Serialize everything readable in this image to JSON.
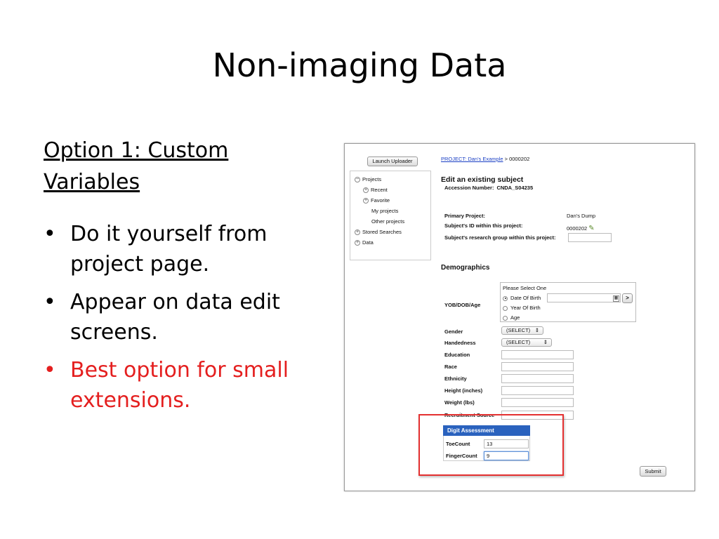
{
  "slide": {
    "title": "Non-imaging Data",
    "heading": "Option 1: Custom Variables",
    "bullets": [
      {
        "text": "Do it yourself from project page."
      },
      {
        "text": "Appear on data edit screens."
      },
      {
        "text": "Best option for small extensions.",
        "color": "#e41f1f"
      }
    ]
  },
  "screenshot": {
    "launch_uploader": "Launch Uploader",
    "tree": {
      "projects": "Projects",
      "recent": "Recent",
      "favorite": "Favorite",
      "my_projects": "My projects",
      "other_projects": "Other projects",
      "stored_searches": "Stored Searches",
      "data": "Data"
    },
    "breadcrumb": {
      "link": "PROJECT: Dan's Example",
      "rest": " > 0000202"
    },
    "heading": "Edit an existing subject",
    "accession_label": "Accession Number:",
    "accession_value": "CNDA_S04235",
    "primary_project_label": "Primary Project:",
    "primary_project_value": "Dan's Dump",
    "subject_id_label": "Subject's ID within this project:",
    "subject_id_value": "0000202",
    "research_group_label": "Subject's research group within this project:",
    "demographics_heading": "Demographics",
    "yob_label": "YOB/DOB/Age",
    "yob_prompt": "Please Select One",
    "yob_options": [
      "Date Of Birth",
      "Year Of Birth",
      "Age"
    ],
    "go_glyph": ">",
    "gender_label": "Gender",
    "gender_value": "(SELECT)",
    "handedness_label": "Handedness",
    "handedness_value": "(SELECT)",
    "education_label": "Education",
    "race_label": "Race",
    "ethnicity_label": "Ethnicity",
    "height_label": "Height (inches)",
    "weight_label": "Weight (lbs)",
    "recruitment_label": "Recruitment Source",
    "digit": {
      "title": "Digit Assessment",
      "toe_label": "ToeCount",
      "toe_value": "13",
      "finger_label": "FingerCount",
      "finger_value": "9"
    },
    "submit": "Submit",
    "highlight_color": "#e43030",
    "header_color": "#2a62be",
    "link_color": "#1a3fc4"
  }
}
